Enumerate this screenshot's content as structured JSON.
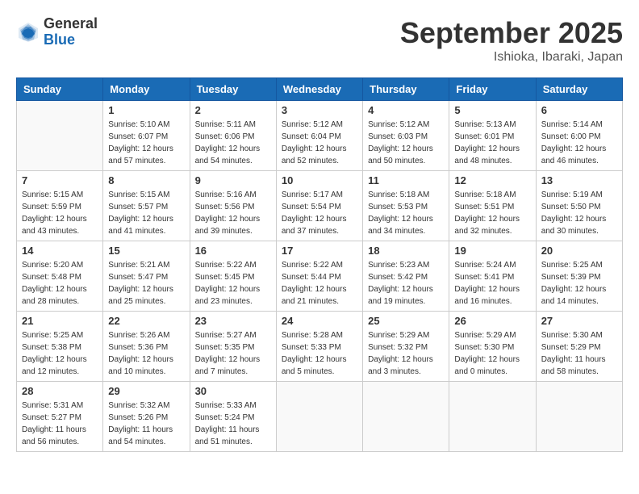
{
  "header": {
    "logo_general": "General",
    "logo_blue": "Blue",
    "month_title": "September 2025",
    "location": "Ishioka, Ibaraki, Japan"
  },
  "columns": [
    "Sunday",
    "Monday",
    "Tuesday",
    "Wednesday",
    "Thursday",
    "Friday",
    "Saturday"
  ],
  "weeks": [
    [
      {
        "day": "",
        "info": ""
      },
      {
        "day": "1",
        "info": "Sunrise: 5:10 AM\nSunset: 6:07 PM\nDaylight: 12 hours\nand 57 minutes."
      },
      {
        "day": "2",
        "info": "Sunrise: 5:11 AM\nSunset: 6:06 PM\nDaylight: 12 hours\nand 54 minutes."
      },
      {
        "day": "3",
        "info": "Sunrise: 5:12 AM\nSunset: 6:04 PM\nDaylight: 12 hours\nand 52 minutes."
      },
      {
        "day": "4",
        "info": "Sunrise: 5:12 AM\nSunset: 6:03 PM\nDaylight: 12 hours\nand 50 minutes."
      },
      {
        "day": "5",
        "info": "Sunrise: 5:13 AM\nSunset: 6:01 PM\nDaylight: 12 hours\nand 48 minutes."
      },
      {
        "day": "6",
        "info": "Sunrise: 5:14 AM\nSunset: 6:00 PM\nDaylight: 12 hours\nand 46 minutes."
      }
    ],
    [
      {
        "day": "7",
        "info": "Sunrise: 5:15 AM\nSunset: 5:59 PM\nDaylight: 12 hours\nand 43 minutes."
      },
      {
        "day": "8",
        "info": "Sunrise: 5:15 AM\nSunset: 5:57 PM\nDaylight: 12 hours\nand 41 minutes."
      },
      {
        "day": "9",
        "info": "Sunrise: 5:16 AM\nSunset: 5:56 PM\nDaylight: 12 hours\nand 39 minutes."
      },
      {
        "day": "10",
        "info": "Sunrise: 5:17 AM\nSunset: 5:54 PM\nDaylight: 12 hours\nand 37 minutes."
      },
      {
        "day": "11",
        "info": "Sunrise: 5:18 AM\nSunset: 5:53 PM\nDaylight: 12 hours\nand 34 minutes."
      },
      {
        "day": "12",
        "info": "Sunrise: 5:18 AM\nSunset: 5:51 PM\nDaylight: 12 hours\nand 32 minutes."
      },
      {
        "day": "13",
        "info": "Sunrise: 5:19 AM\nSunset: 5:50 PM\nDaylight: 12 hours\nand 30 minutes."
      }
    ],
    [
      {
        "day": "14",
        "info": "Sunrise: 5:20 AM\nSunset: 5:48 PM\nDaylight: 12 hours\nand 28 minutes."
      },
      {
        "day": "15",
        "info": "Sunrise: 5:21 AM\nSunset: 5:47 PM\nDaylight: 12 hours\nand 25 minutes."
      },
      {
        "day": "16",
        "info": "Sunrise: 5:22 AM\nSunset: 5:45 PM\nDaylight: 12 hours\nand 23 minutes."
      },
      {
        "day": "17",
        "info": "Sunrise: 5:22 AM\nSunset: 5:44 PM\nDaylight: 12 hours\nand 21 minutes."
      },
      {
        "day": "18",
        "info": "Sunrise: 5:23 AM\nSunset: 5:42 PM\nDaylight: 12 hours\nand 19 minutes."
      },
      {
        "day": "19",
        "info": "Sunrise: 5:24 AM\nSunset: 5:41 PM\nDaylight: 12 hours\nand 16 minutes."
      },
      {
        "day": "20",
        "info": "Sunrise: 5:25 AM\nSunset: 5:39 PM\nDaylight: 12 hours\nand 14 minutes."
      }
    ],
    [
      {
        "day": "21",
        "info": "Sunrise: 5:25 AM\nSunset: 5:38 PM\nDaylight: 12 hours\nand 12 minutes."
      },
      {
        "day": "22",
        "info": "Sunrise: 5:26 AM\nSunset: 5:36 PM\nDaylight: 12 hours\nand 10 minutes."
      },
      {
        "day": "23",
        "info": "Sunrise: 5:27 AM\nSunset: 5:35 PM\nDaylight: 12 hours\nand 7 minutes."
      },
      {
        "day": "24",
        "info": "Sunrise: 5:28 AM\nSunset: 5:33 PM\nDaylight: 12 hours\nand 5 minutes."
      },
      {
        "day": "25",
        "info": "Sunrise: 5:29 AM\nSunset: 5:32 PM\nDaylight: 12 hours\nand 3 minutes."
      },
      {
        "day": "26",
        "info": "Sunrise: 5:29 AM\nSunset: 5:30 PM\nDaylight: 12 hours\nand 0 minutes."
      },
      {
        "day": "27",
        "info": "Sunrise: 5:30 AM\nSunset: 5:29 PM\nDaylight: 11 hours\nand 58 minutes."
      }
    ],
    [
      {
        "day": "28",
        "info": "Sunrise: 5:31 AM\nSunset: 5:27 PM\nDaylight: 11 hours\nand 56 minutes."
      },
      {
        "day": "29",
        "info": "Sunrise: 5:32 AM\nSunset: 5:26 PM\nDaylight: 11 hours\nand 54 minutes."
      },
      {
        "day": "30",
        "info": "Sunrise: 5:33 AM\nSunset: 5:24 PM\nDaylight: 11 hours\nand 51 minutes."
      },
      {
        "day": "",
        "info": ""
      },
      {
        "day": "",
        "info": ""
      },
      {
        "day": "",
        "info": ""
      },
      {
        "day": "",
        "info": ""
      }
    ]
  ]
}
